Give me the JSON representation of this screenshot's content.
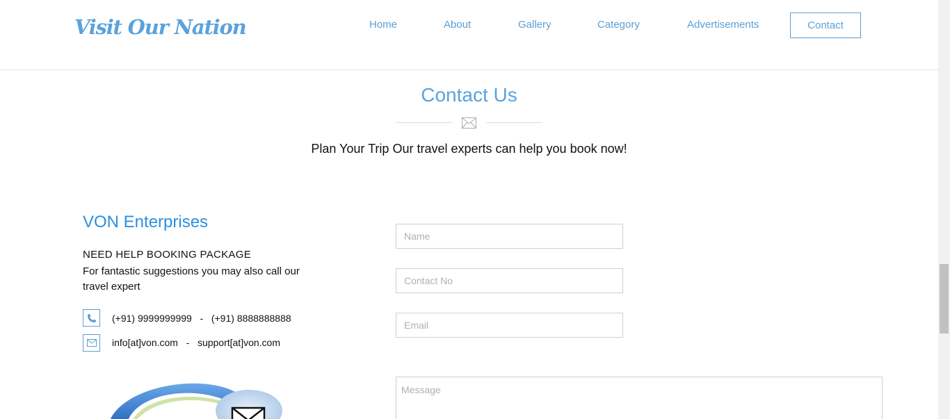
{
  "header": {
    "logo": "Visit Our Nation",
    "nav": [
      {
        "label": "Home"
      },
      {
        "label": "About"
      },
      {
        "label": "Gallery"
      },
      {
        "label": "Category"
      },
      {
        "label": "Advertisements"
      },
      {
        "label": "Contact",
        "active": true
      }
    ]
  },
  "main": {
    "title": "Contact Us",
    "subtitle": "Plan Your Trip Our travel experts can help you book now!"
  },
  "info": {
    "company": "VON Enterprises",
    "help_heading": "NEED HELP BOOKING PACKAGE",
    "help_text": "For fantastic suggestions you may also call our travel expert",
    "phone_line": "(+91) 9999999999   -   (+91) 8888888888",
    "email_line": "info[at]von.com   -   support[at]von.com"
  },
  "form": {
    "name_placeholder": "Name",
    "contact_placeholder": "Contact No",
    "email_placeholder": "Email",
    "message_placeholder": "Message"
  },
  "colors": {
    "accent": "#5aa2dd",
    "heading_blue": "#2b8fe0",
    "border": "#cfcfcf"
  },
  "icons": [
    "envelope-icon",
    "phone-icon",
    "mail-icon",
    "mail-envelope-graphic"
  ]
}
